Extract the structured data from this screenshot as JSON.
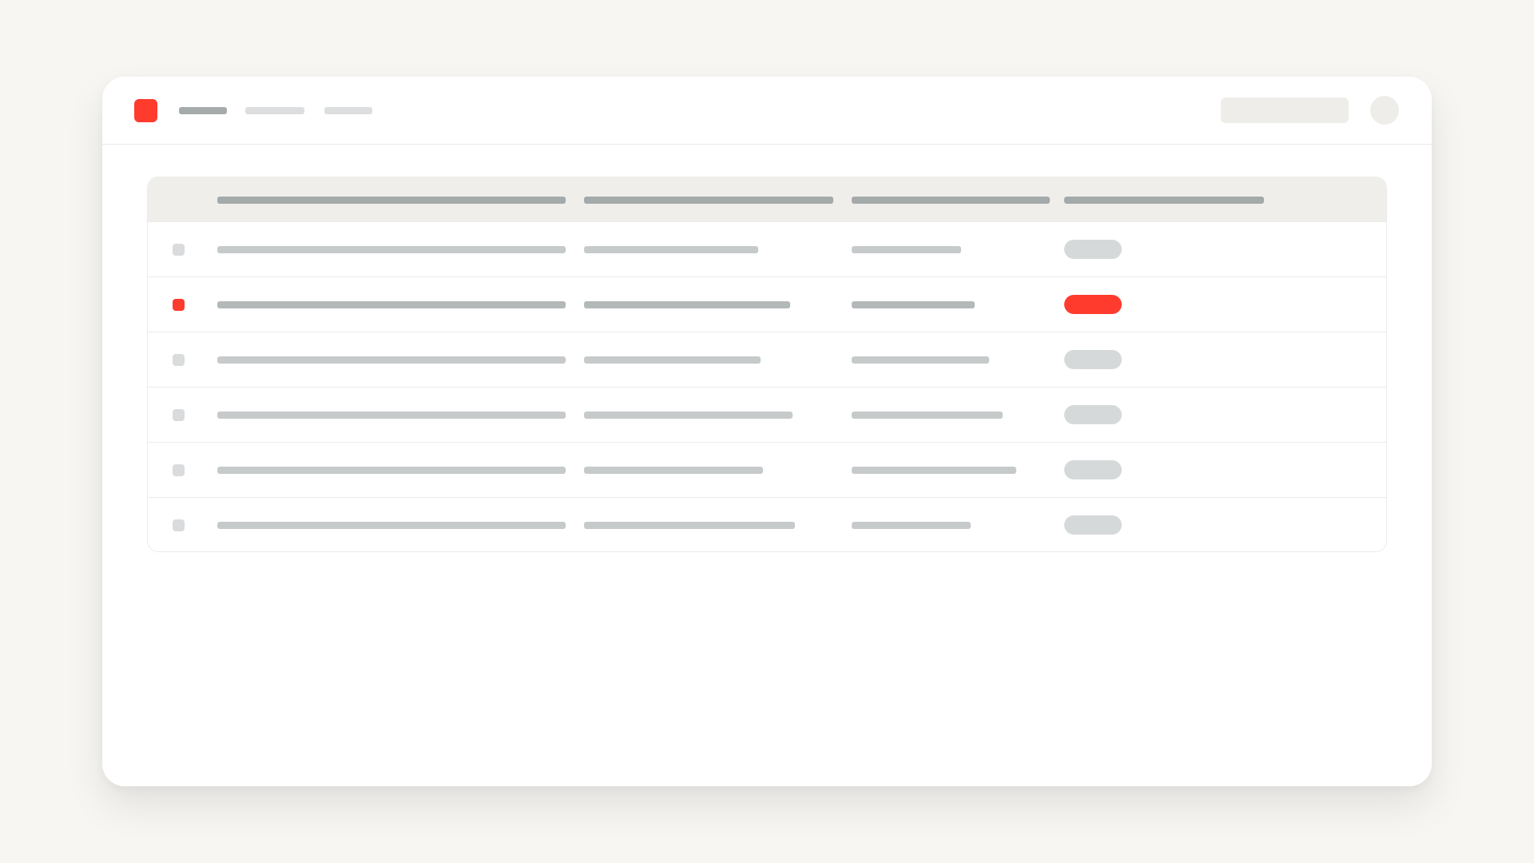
{
  "colors": {
    "page_background": "#f7f6f3",
    "accent": "#ff3b2e",
    "nav_active": "#a5aaab",
    "nav_inactive": "#dcdedf",
    "header_bar": "#a4a9aa",
    "cell_placeholder": "#c6cacb",
    "cell_placeholder_selected": "#b3b8b9",
    "badge_neutral": "#d6d9da",
    "badge_highlight": "#ff3b2e"
  },
  "header": {
    "logo_icon": "app-logo-icon",
    "nav_items": [
      {
        "name": "nav-item-1",
        "active": true
      },
      {
        "name": "nav-item-2",
        "active": false
      },
      {
        "name": "nav-item-3",
        "active": false
      }
    ],
    "search": {
      "value": "",
      "placeholder": ""
    },
    "avatar_icon": "user-avatar-icon"
  },
  "table": {
    "columns": [
      "",
      "",
      "",
      ""
    ],
    "rows": [
      {
        "cells": [
          "",
          "",
          ""
        ],
        "status": "",
        "checked": false,
        "badge_highlight": false
      },
      {
        "cells": [
          "",
          "",
          ""
        ],
        "status": "",
        "checked": true,
        "badge_highlight": true
      },
      {
        "cells": [
          "",
          "",
          ""
        ],
        "status": "",
        "checked": false,
        "badge_highlight": false
      },
      {
        "cells": [
          "",
          "",
          ""
        ],
        "status": "",
        "checked": false,
        "badge_highlight": false
      },
      {
        "cells": [
          "",
          "",
          ""
        ],
        "status": "",
        "checked": false,
        "badge_highlight": false
      },
      {
        "cells": [
          "",
          "",
          ""
        ],
        "status": "",
        "checked": false,
        "badge_highlight": false
      }
    ]
  }
}
